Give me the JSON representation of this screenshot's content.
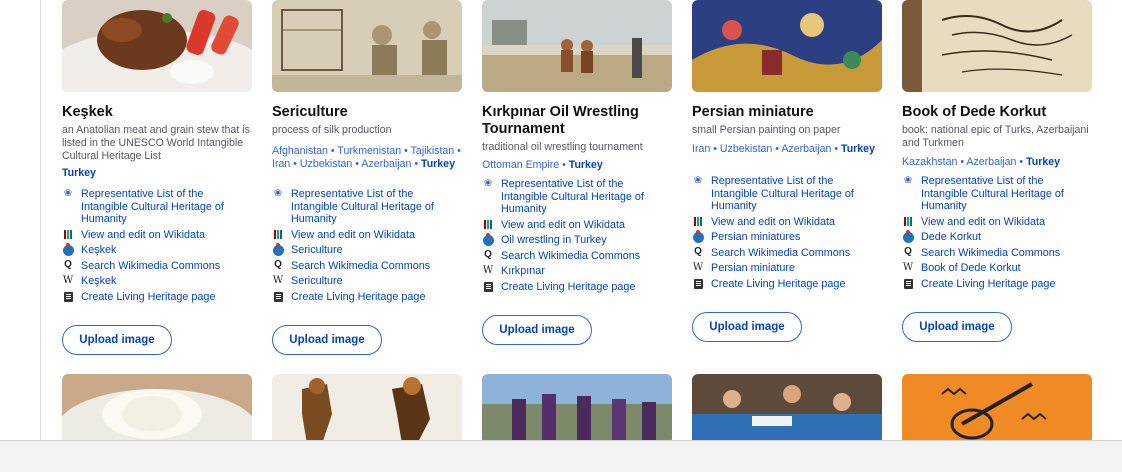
{
  "cards": [
    {
      "title": "Keşkek",
      "desc": "an Anatolian meat and grain stew that is listed in the UNESCO World Intangible Cultural Heritage List",
      "countries": [
        {
          "name": "Turkey",
          "hl": true
        }
      ],
      "links": [
        {
          "icon": "laurel-icon",
          "text": "Representative List of the Intangible Cultural Heritage of Humanity"
        },
        {
          "icon": "wikidata-icon",
          "text": "View and edit on Wikidata"
        },
        {
          "icon": "commons-icon",
          "text": "Keşkek"
        },
        {
          "icon": "search-icon",
          "text": "Search Wikimedia Commons"
        },
        {
          "icon": "wikipedia-icon",
          "text": "Keşkek"
        },
        {
          "icon": "document-icon",
          "text": "Create Living Heritage page"
        }
      ],
      "upload": "Upload image"
    },
    {
      "title": "Sericulture",
      "desc": "process of silk production",
      "countries": [
        {
          "name": "Afghanistan",
          "hl": false
        },
        {
          "name": "Turkmenistan",
          "hl": false
        },
        {
          "name": "Tajikistan",
          "hl": false
        },
        {
          "name": "Iran",
          "hl": false
        },
        {
          "name": "Uzbekistan",
          "hl": false
        },
        {
          "name": "Azerbaijan",
          "hl": false
        },
        {
          "name": "Turkey",
          "hl": true
        }
      ],
      "links": [
        {
          "icon": "laurel-icon",
          "text": "Representative List of the Intangible Cultural Heritage of Humanity"
        },
        {
          "icon": "wikidata-icon",
          "text": "View and edit on Wikidata"
        },
        {
          "icon": "commons-icon",
          "text": "Sericulture"
        },
        {
          "icon": "search-icon",
          "text": "Search Wikimedia Commons"
        },
        {
          "icon": "wikipedia-icon",
          "text": "Sericulture"
        },
        {
          "icon": "document-icon",
          "text": "Create Living Heritage page"
        }
      ],
      "upload": "Upload image"
    },
    {
      "title": "Kırkpınar Oil Wrestling Tournament",
      "desc": "traditional oil wrestling tournament",
      "countries": [
        {
          "name": "Ottoman Empire",
          "hl": false
        },
        {
          "name": "Turkey",
          "hl": true
        }
      ],
      "links": [
        {
          "icon": "laurel-icon",
          "text": "Representative List of the Intangible Cultural Heritage of Humanity"
        },
        {
          "icon": "wikidata-icon",
          "text": "View and edit on Wikidata"
        },
        {
          "icon": "commons-icon",
          "text": "Oil wrestling in Turkey"
        },
        {
          "icon": "search-icon",
          "text": "Search Wikimedia Commons"
        },
        {
          "icon": "wikipedia-icon",
          "text": "Kırkpınar"
        },
        {
          "icon": "document-icon",
          "text": "Create Living Heritage page"
        }
      ],
      "upload": "Upload image"
    },
    {
      "title": "Persian miniature",
      "desc": "small Persian painting on paper",
      "countries": [
        {
          "name": "Iran",
          "hl": false
        },
        {
          "name": "Uzbekistan",
          "hl": false
        },
        {
          "name": "Azerbaijan",
          "hl": false
        },
        {
          "name": "Turkey",
          "hl": true
        }
      ],
      "links": [
        {
          "icon": "laurel-icon",
          "text": "Representative List of the Intangible Cultural Heritage of Humanity"
        },
        {
          "icon": "wikidata-icon",
          "text": "View and edit on Wikidata"
        },
        {
          "icon": "commons-icon",
          "text": "Persian miniatures"
        },
        {
          "icon": "search-icon",
          "text": "Search Wikimedia Commons"
        },
        {
          "icon": "wikipedia-icon",
          "text": "Persian miniature"
        },
        {
          "icon": "document-icon",
          "text": "Create Living Heritage page"
        }
      ],
      "upload": "Upload image"
    },
    {
      "title": "Book of Dede Korkut",
      "desc": "book: national epic of Turks, Azerbaijani and Turkmen",
      "countries": [
        {
          "name": "Kazakhstan",
          "hl": false
        },
        {
          "name": "Azerbaijan",
          "hl": false
        },
        {
          "name": "Turkey",
          "hl": true
        }
      ],
      "links": [
        {
          "icon": "laurel-icon",
          "text": "Representative List of the Intangible Cultural Heritage of Humanity"
        },
        {
          "icon": "wikidata-icon",
          "text": "View and edit on Wikidata"
        },
        {
          "icon": "commons-icon",
          "text": "Dede Korkut"
        },
        {
          "icon": "search-icon",
          "text": "Search Wikimedia Commons"
        },
        {
          "icon": "wikipedia-icon",
          "text": "Book of Dede Korkut"
        },
        {
          "icon": "document-icon",
          "text": "Create Living Heritage page"
        }
      ],
      "upload": "Upload image"
    }
  ],
  "colors": {
    "link": "#0645ad",
    "button_border": "#3366cc",
    "desc": "#54595d"
  }
}
